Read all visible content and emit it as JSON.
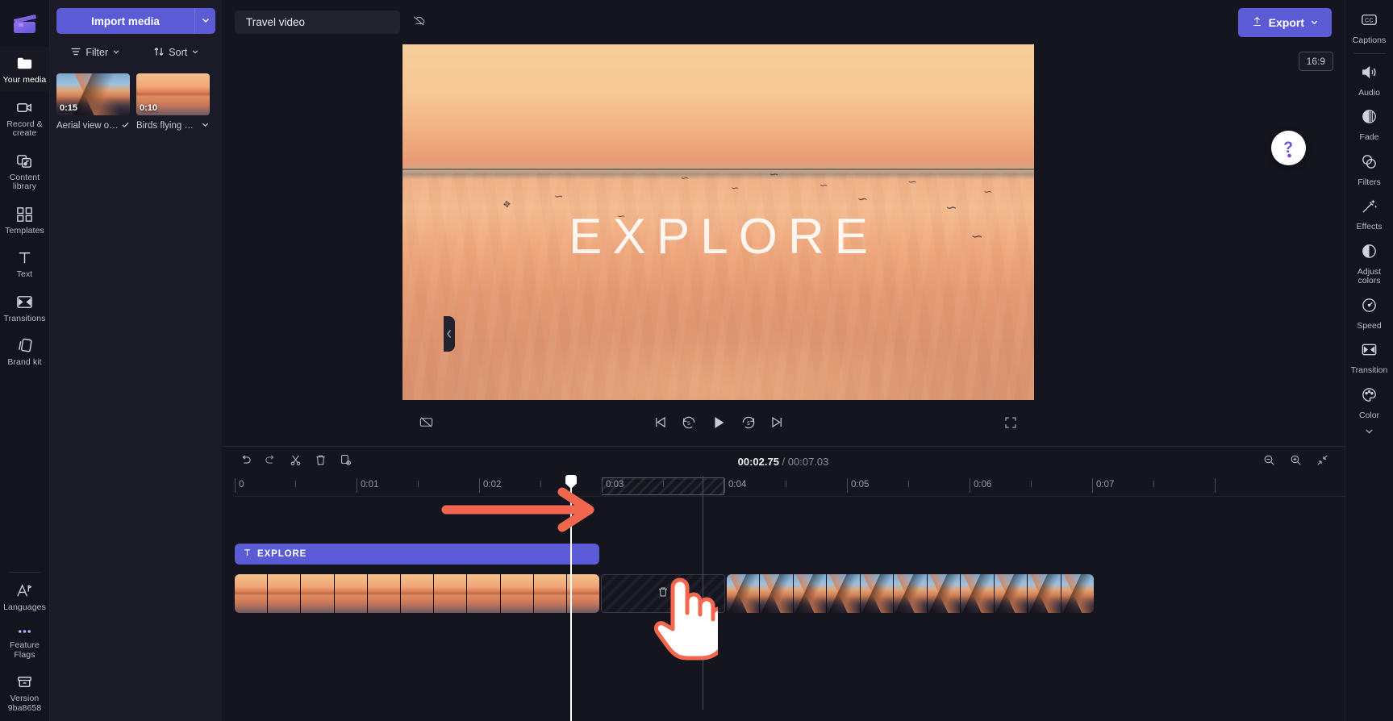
{
  "app": {
    "name": "Clipchamp",
    "accent": "#5b5bd6",
    "bg": "#15151f",
    "panel_bg": "#1b1b27"
  },
  "left_rail": {
    "items": [
      {
        "label": "Your media",
        "icon": "folder-icon",
        "active": true
      },
      {
        "label": "Record &\ncreate",
        "icon": "camera-icon",
        "active": false
      },
      {
        "label": "Content\nlibrary",
        "icon": "library-icon",
        "active": false
      },
      {
        "label": "Templates",
        "icon": "templates-icon",
        "active": false
      },
      {
        "label": "Text",
        "icon": "text-icon",
        "active": false
      },
      {
        "label": "Transitions",
        "icon": "transitions-icon",
        "active": false
      },
      {
        "label": "Brand kit",
        "icon": "brandkit-icon",
        "active": false
      }
    ],
    "bottom_items": [
      {
        "label": "Languages",
        "icon": "language-icon"
      },
      {
        "label": "Feature\nFlags",
        "icon": "ellipsis-icon"
      },
      {
        "label": "Version\n9ba8658",
        "icon": "version-icon"
      }
    ]
  },
  "media_panel": {
    "import_label": "Import media",
    "import_caret_icon": "chevron-down-icon",
    "filter_label": "Filter",
    "filter_icon": "filter-icon",
    "sort_label": "Sort",
    "sort_icon": "sort-icon",
    "items": [
      {
        "name": "Aerial view of ...",
        "duration": "0:15",
        "thumb": "mountain",
        "check_icon": "check-icon"
      },
      {
        "name": "Birds flying ab...",
        "duration": "0:10",
        "thumb": "sunset",
        "check_icon": "chevron-down-icon"
      }
    ]
  },
  "topbar": {
    "project_title": "Travel video",
    "cloud_icon": "cloud-off-icon",
    "export_label": "Export",
    "export_icon": "upload-icon",
    "export_caret_icon": "chevron-down-icon"
  },
  "preview": {
    "overlay_text": "EXPLORE",
    "aspect_ratio": "16:9",
    "controls": [
      {
        "name": "skip-to-start",
        "icon": "skip-back-icon"
      },
      {
        "name": "rewind-5s",
        "icon": "rewind-5-icon"
      },
      {
        "name": "play",
        "icon": "play-icon"
      },
      {
        "name": "forward-5s",
        "icon": "forward-5-icon"
      },
      {
        "name": "skip-to-end",
        "icon": "skip-forward-icon"
      }
    ],
    "captions_toggle_icon": "captions-off-icon",
    "fullscreen_icon": "fullscreen-icon"
  },
  "help": {
    "icon": "question-mark-icon",
    "accent": "#6d4ae0"
  },
  "timeline": {
    "toolbar": [
      {
        "name": "undo",
        "icon": "undo-icon"
      },
      {
        "name": "redo",
        "icon": "redo-icon"
      },
      {
        "name": "split",
        "icon": "scissors-icon"
      },
      {
        "name": "delete",
        "icon": "trash-icon"
      },
      {
        "name": "duplicate",
        "icon": "duplicate-icon"
      }
    ],
    "current_time": "00:02.75",
    "separator": " / ",
    "total_time": "00:07.03",
    "zoom_controls": [
      {
        "name": "zoom-out",
        "icon": "zoom-out-icon"
      },
      {
        "name": "zoom-in",
        "icon": "zoom-in-icon"
      },
      {
        "name": "fit",
        "icon": "fit-icon"
      }
    ],
    "ruler_labels": [
      "0",
      "0:01",
      "0:02",
      "0:03",
      "0:04",
      "0:05",
      "0:06",
      "0:07"
    ],
    "playhead_time": "00:02.75",
    "selection_range": {
      "start_label": "0:03",
      "end_label": "0:04"
    },
    "tracks": [
      {
        "type": "text",
        "clip_label": "EXPLORE",
        "icon": "text-clip-icon"
      },
      {
        "type": "video",
        "clips": [
          {
            "name": "Birds flying ab...",
            "thumb": "sunset",
            "frames": 11
          },
          {
            "name": "Aerial view of ...",
            "thumb": "mountain",
            "frames": 11
          }
        ],
        "gap_icon": "trash-icon"
      }
    ]
  },
  "annotations": {
    "arrow_color": "#f4674f",
    "hand_color": "#ffffff",
    "hand_outline": "#f4674f"
  },
  "right_rail": {
    "top": {
      "label": "Captions",
      "icon": "captions-icon"
    },
    "items": [
      {
        "label": "Audio",
        "icon": "audio-icon"
      },
      {
        "label": "Fade",
        "icon": "fade-icon"
      },
      {
        "label": "Filters",
        "icon": "filters-icon"
      },
      {
        "label": "Effects",
        "icon": "effects-icon"
      },
      {
        "label": "Adjust\ncolors",
        "icon": "adjust-colors-icon"
      },
      {
        "label": "Speed",
        "icon": "speed-icon"
      },
      {
        "label": "Transition",
        "icon": "transition-icon"
      },
      {
        "label": "Color",
        "icon": "color-icon"
      }
    ],
    "more_icon": "chevron-down-icon"
  }
}
